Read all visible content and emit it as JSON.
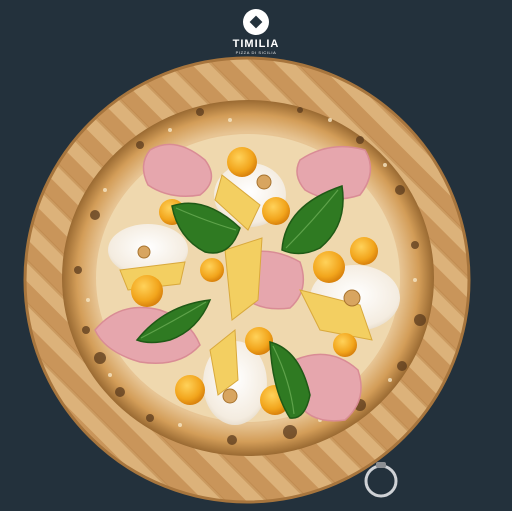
{
  "brand": {
    "name": "TIMILIA",
    "tagline": "PIZZA DI SICILIA",
    "icon": "timilia-logo-icon"
  },
  "photo": {
    "subject": "pizza-on-wooden-board-photo",
    "colors": {
      "background": "#23313c",
      "board_light": "#dcb27a",
      "board_dark": "#c9955a",
      "crust": "#d9a866",
      "cheese": "#f6efe2",
      "ham": "#e6a6ad",
      "tomato": "#f2a51c",
      "basil": "#2f7a22"
    }
  }
}
